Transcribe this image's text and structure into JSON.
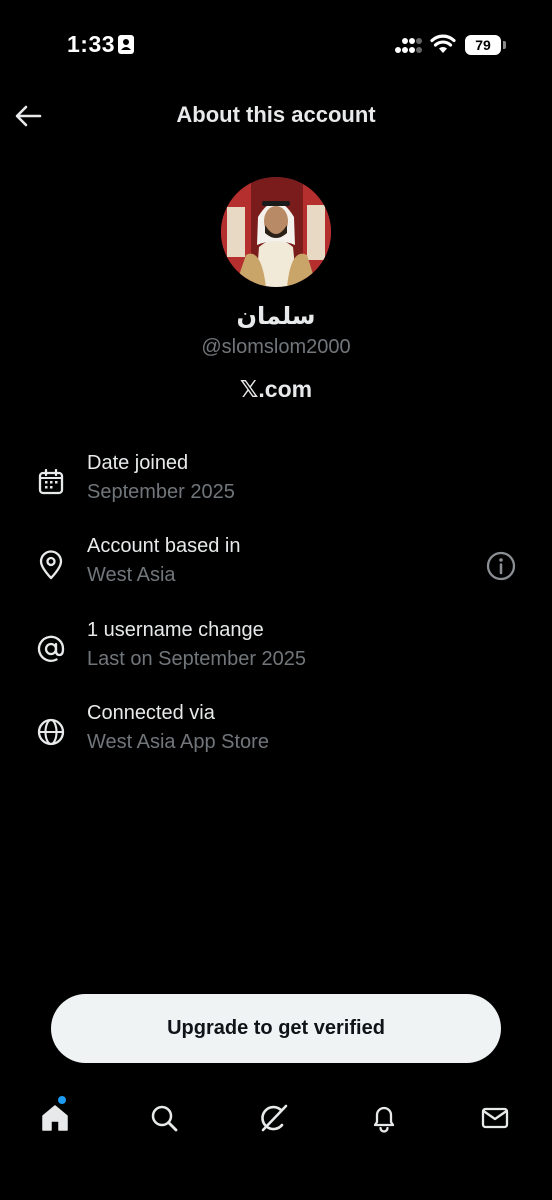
{
  "status_bar": {
    "time": "1:33",
    "battery": "79"
  },
  "header": {
    "title": "About this account"
  },
  "profile": {
    "display_name": "سلمان",
    "handle": "@slomslom2000",
    "site": "𝕏.com"
  },
  "info_rows": [
    {
      "icon": "calendar-icon",
      "label": "Date joined",
      "value": "September 2025"
    },
    {
      "icon": "location-pin-icon",
      "label": "Account based in",
      "value": "West Asia"
    },
    {
      "icon": "at-sign-icon",
      "label": "1 username change",
      "value": "Last on September 2025"
    },
    {
      "icon": "globe-icon",
      "label": "Connected via",
      "value": "West Asia App Store"
    }
  ],
  "upgrade": {
    "label": "Upgrade to get verified"
  },
  "bottom_nav": [
    {
      "icon": "home-icon",
      "active": true,
      "badge": true
    },
    {
      "icon": "search-icon"
    },
    {
      "icon": "grok-icon"
    },
    {
      "icon": "bell-icon"
    },
    {
      "icon": "mail-icon"
    }
  ],
  "colors": {
    "background": "#000000",
    "primary_text": "#e7e9ea",
    "secondary_text": "#71767b",
    "accent": "#1d9bf0",
    "button_bg": "#eff3f4"
  }
}
